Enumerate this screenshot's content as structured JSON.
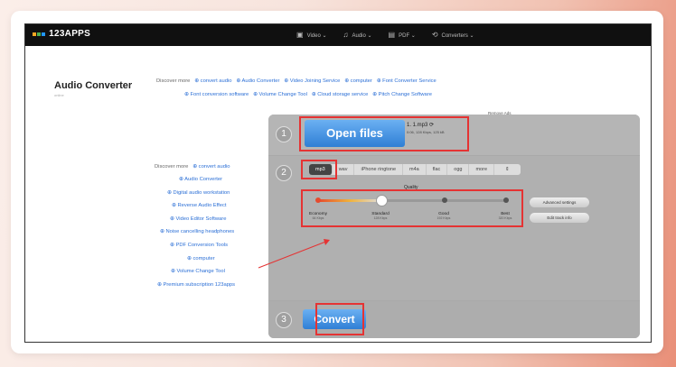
{
  "logo": "123APPS",
  "nav": [
    {
      "icon": "▣",
      "label": "Video ⌄",
      "name": "nav-video"
    },
    {
      "icon": "♫",
      "label": "Audio ⌄",
      "name": "nav-audio"
    },
    {
      "icon": "▤",
      "label": "PDF ⌄",
      "name": "nav-pdf"
    },
    {
      "icon": "⟲",
      "label": "Converters ⌄",
      "name": "nav-converters"
    }
  ],
  "page": {
    "title": "Audio Converter",
    "subtitle": "online"
  },
  "top_discover": {
    "line1": [
      "Discover more",
      "⊕ convert audio",
      "⊕ Audio Converter",
      "⊕ Video Joining Service",
      "⊕ computer",
      "⊕ Font Converter Service"
    ],
    "line2": [
      "⊕ Font conversion software",
      "⊕ Volume Change Tool",
      "⊕ Cloud storage service",
      "⊕ Pitch Change Software"
    ]
  },
  "side_discover": [
    "⊕ Audio Converter",
    "⊕ Digital audio workstation",
    "⊕ Reverse Audio Effect",
    "⊕ Video Editor Software",
    "⊕ Noise cancelling headphones",
    "⊕ PDF Conversion Tools",
    "⊕ computer",
    "⊕ Volume Change Tool",
    "⊕ Premium subscription 123apps"
  ],
  "side_discover_head": [
    "Discover more",
    "⊕ convert audio"
  ],
  "remove_ads": "Remove Ads",
  "step_numbers": [
    "1",
    "2",
    "3"
  ],
  "open_files": "Open files",
  "file": {
    "name": "1. 1.mp3 ⟳",
    "meta": "0:06, 128 Kbps, 125 kB"
  },
  "formats": [
    "mp3",
    "wav",
    "iPhone ringtone",
    "m4a",
    "flac",
    "ogg",
    "more",
    "⇕"
  ],
  "quality": {
    "title": "Quality",
    "level": "Standard",
    "levels": [
      {
        "label": "Economy",
        "rate": "64 Kbps"
      },
      {
        "label": "Standard",
        "rate": "128 Kbps"
      },
      {
        "label": "Good",
        "rate": "192 Kbps"
      },
      {
        "label": "Best",
        "rate": "320 Kbps"
      }
    ]
  },
  "advanced": "Advanced settings",
  "edit_track": "Edit track info",
  "convert": "Convert",
  "colors": {
    "accent": "#2f7fd5",
    "highlight": "#e53333"
  }
}
